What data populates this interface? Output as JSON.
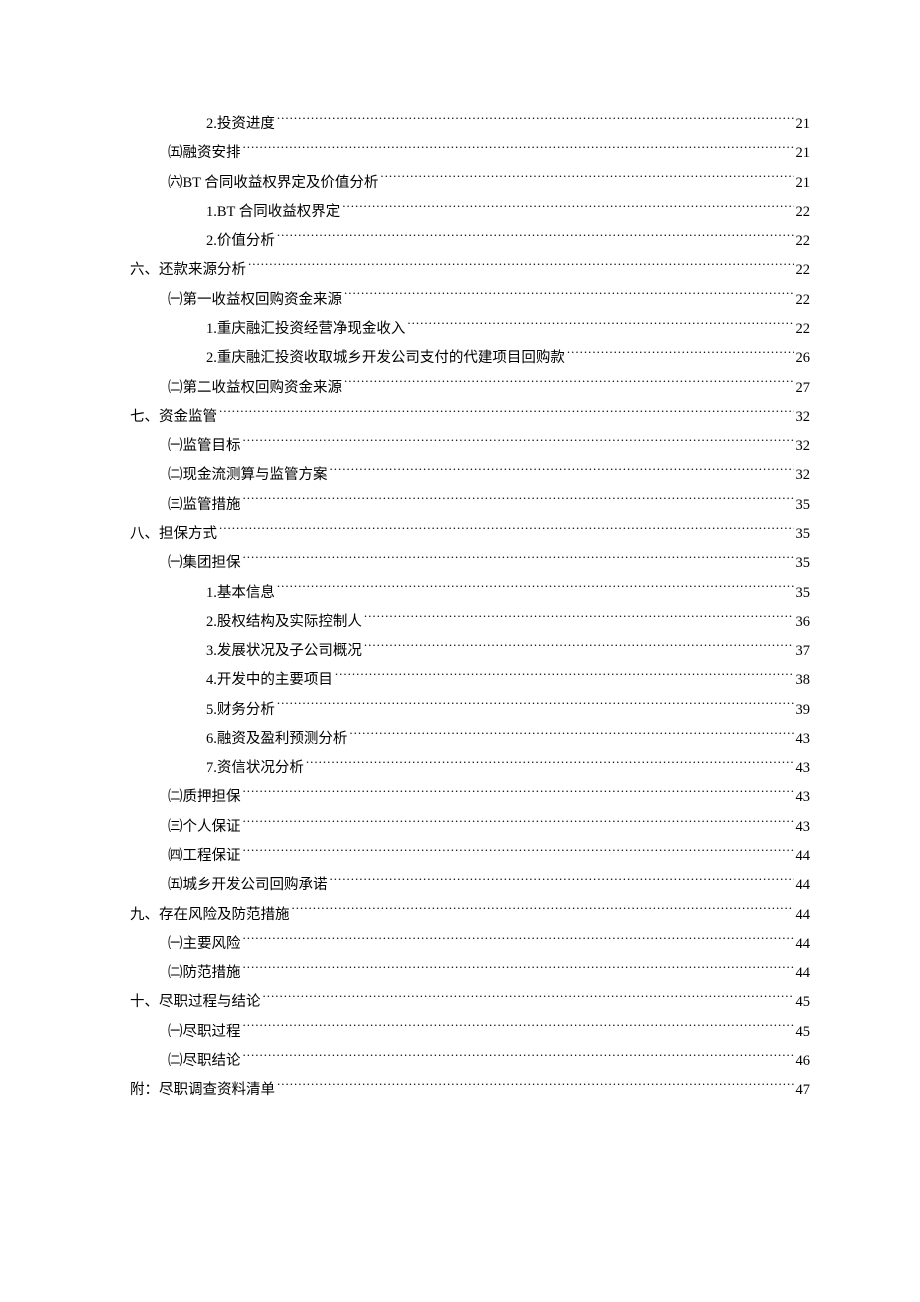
{
  "toc": [
    {
      "level": 3,
      "label": "2.投资进度",
      "page": "21"
    },
    {
      "level": 2,
      "label": "㈤融资安排",
      "page": "21"
    },
    {
      "level": 2,
      "label": "㈥BT 合同收益权界定及价值分析",
      "page": "21"
    },
    {
      "level": 3,
      "label": "1.BT 合同收益权界定",
      "page": "22"
    },
    {
      "level": 3,
      "label": "2.价值分析",
      "page": "22"
    },
    {
      "level": 1,
      "label": "六、还款来源分析",
      "page": "22"
    },
    {
      "level": 2,
      "label": "㈠第一收益权回购资金来源",
      "page": "22"
    },
    {
      "level": 3,
      "label": "1.重庆融汇投资经营净现金收入",
      "page": "22"
    },
    {
      "level": 3,
      "label": "2.重庆融汇投资收取城乡开发公司支付的代建项目回购款",
      "page": "26"
    },
    {
      "level": 2,
      "label": "㈡第二收益权回购资金来源",
      "page": "27"
    },
    {
      "level": 1,
      "label": "七、资金监管",
      "page": "32"
    },
    {
      "level": 2,
      "label": "㈠监管目标",
      "page": "32"
    },
    {
      "level": 2,
      "label": "㈡现金流测算与监管方案",
      "page": "32"
    },
    {
      "level": 2,
      "label": "㈢监管措施",
      "page": "35"
    },
    {
      "level": 1,
      "label": "八、担保方式",
      "page": "35"
    },
    {
      "level": 2,
      "label": "㈠集团担保",
      "page": "35"
    },
    {
      "level": 3,
      "label": "1.基本信息",
      "page": "35"
    },
    {
      "level": 3,
      "label": "2.股权结构及实际控制人",
      "page": "36"
    },
    {
      "level": 3,
      "label": "3.发展状况及子公司概况",
      "page": "37"
    },
    {
      "level": 3,
      "label": "4.开发中的主要项目",
      "page": "38"
    },
    {
      "level": 3,
      "label": "5.财务分析",
      "page": "39"
    },
    {
      "level": 3,
      "label": "6.融资及盈利预测分析",
      "page": "43"
    },
    {
      "level": 3,
      "label": "7.资信状况分析",
      "page": "43"
    },
    {
      "level": 2,
      "label": "㈡质押担保",
      "page": "43"
    },
    {
      "level": 2,
      "label": "㈢个人保证",
      "page": "43"
    },
    {
      "level": 2,
      "label": "㈣工程保证",
      "page": "44"
    },
    {
      "level": 2,
      "label": "㈤城乡开发公司回购承诺",
      "page": "44"
    },
    {
      "level": 1,
      "label": "九、存在风险及防范措施",
      "page": "44"
    },
    {
      "level": 2,
      "label": "㈠主要风险",
      "page": "44"
    },
    {
      "level": 2,
      "label": "㈡防范措施",
      "page": "44"
    },
    {
      "level": 1,
      "label": "十、尽职过程与结论",
      "page": "45"
    },
    {
      "level": 2,
      "label": "㈠尽职过程",
      "page": "45"
    },
    {
      "level": 2,
      "label": "㈡尽职结论",
      "page": "46"
    },
    {
      "level": 1,
      "label": "附：尽职调查资料清单",
      "page": "47"
    }
  ]
}
